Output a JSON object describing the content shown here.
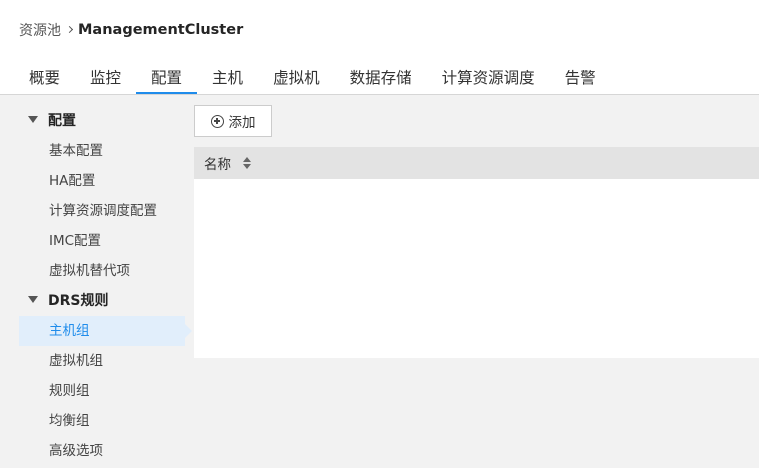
{
  "breadcrumb": {
    "parent": "资源池",
    "current": "ManagementCluster"
  },
  "tabs": [
    {
      "label": "概要",
      "active": false
    },
    {
      "label": "监控",
      "active": false
    },
    {
      "label": "配置",
      "active": true
    },
    {
      "label": "主机",
      "active": false
    },
    {
      "label": "虚拟机",
      "active": false
    },
    {
      "label": "数据存储",
      "active": false
    },
    {
      "label": "计算资源调度",
      "active": false
    },
    {
      "label": "告警",
      "active": false
    }
  ],
  "sidebar": {
    "groups": [
      {
        "label": "配置",
        "expanded": true,
        "items": [
          {
            "label": "基本配置"
          },
          {
            "label": "HA配置"
          },
          {
            "label": "计算资源调度配置"
          },
          {
            "label": "IMC配置"
          },
          {
            "label": "虚拟机替代项"
          }
        ]
      },
      {
        "label": "DRS规则",
        "expanded": true,
        "items": [
          {
            "label": "主机组",
            "selected": true
          },
          {
            "label": "虚拟机组"
          },
          {
            "label": "规则组"
          },
          {
            "label": "均衡组"
          },
          {
            "label": "高级选项"
          }
        ]
      }
    ]
  },
  "main": {
    "add_button": {
      "label": "添加",
      "icon": "plus-circle-icon"
    },
    "table": {
      "columns": [
        {
          "label": "名称",
          "sortable": true
        }
      ],
      "rows": []
    }
  },
  "colors": {
    "accent": "#1f8ceb",
    "selected_bg": "#e1eefb",
    "panel_bg": "#f2f2f2",
    "table_header_bg": "#e3e3e3"
  }
}
